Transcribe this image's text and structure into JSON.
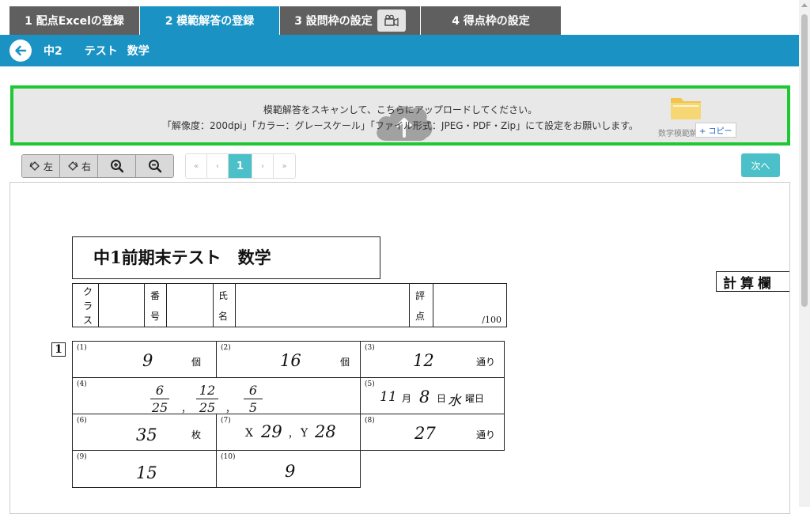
{
  "tabs": [
    {
      "label": "1 配点Excelの登録",
      "active": false
    },
    {
      "label": "2 模範解答の登録",
      "active": true
    },
    {
      "label": "3 設問枠の設定",
      "active": false
    },
    {
      "label": "4 得点枠の設定",
      "active": false
    }
  ],
  "header": {
    "grade": "中2",
    "test": "テスト",
    "subject": "数学"
  },
  "upload": {
    "line1": "模範解答をスキャンして、こちらにアップロードしてください。",
    "line2": "「解像度：200dpi」「カラー：グレースケール」「ファイル形式：JPEG・PDF・Zip」にて設定をお願いします。",
    "folder_label": "数学模範解",
    "copy_badge": "+ コピー"
  },
  "toolbar": {
    "rotate_left": "左",
    "rotate_right": "右"
  },
  "pager": {
    "first": "«",
    "prev": "‹",
    "current": "1",
    "next": "›",
    "last": "»"
  },
  "next_button": "次へ",
  "document": {
    "title": "中1前期末テスト　数学",
    "calc_box": "計算欄",
    "info": {
      "class_label": [
        "ク",
        "ラ",
        "ス"
      ],
      "number_label": [
        "番",
        "号"
      ],
      "name_label": [
        "氏",
        "名"
      ],
      "score_label": [
        "評",
        "点"
      ],
      "score_max": "/100"
    },
    "question_number": "1",
    "answers": {
      "q1": {
        "num": "(1)",
        "value": "9",
        "unit": "個"
      },
      "q2": {
        "num": "(2)",
        "value": "16",
        "unit": "個"
      },
      "q3": {
        "num": "(3)",
        "value": "12",
        "unit": "通り"
      },
      "q4": {
        "num": "(4)",
        "fractions": [
          [
            "6",
            "25"
          ],
          [
            "12",
            "25"
          ],
          [
            "6",
            "5"
          ]
        ],
        "sep": "，"
      },
      "q5": {
        "num": "(5)",
        "month": "11",
        "month_unit": "月",
        "day": "8",
        "day_unit": "日",
        "weekday": "水",
        "weekday_unit": "曜日"
      },
      "q6": {
        "num": "(6)",
        "value": "35",
        "unit": "枚"
      },
      "q7": {
        "num": "(7)",
        "x_label": "X",
        "x_value": "29",
        "sep": "，",
        "y_label": "Y",
        "y_value": "28"
      },
      "q8": {
        "num": "(8)",
        "value": "27",
        "unit": "通り"
      },
      "q9": {
        "num": "(9)",
        "value": "15"
      },
      "q10": {
        "num": "(10)",
        "value": "9"
      }
    }
  }
}
